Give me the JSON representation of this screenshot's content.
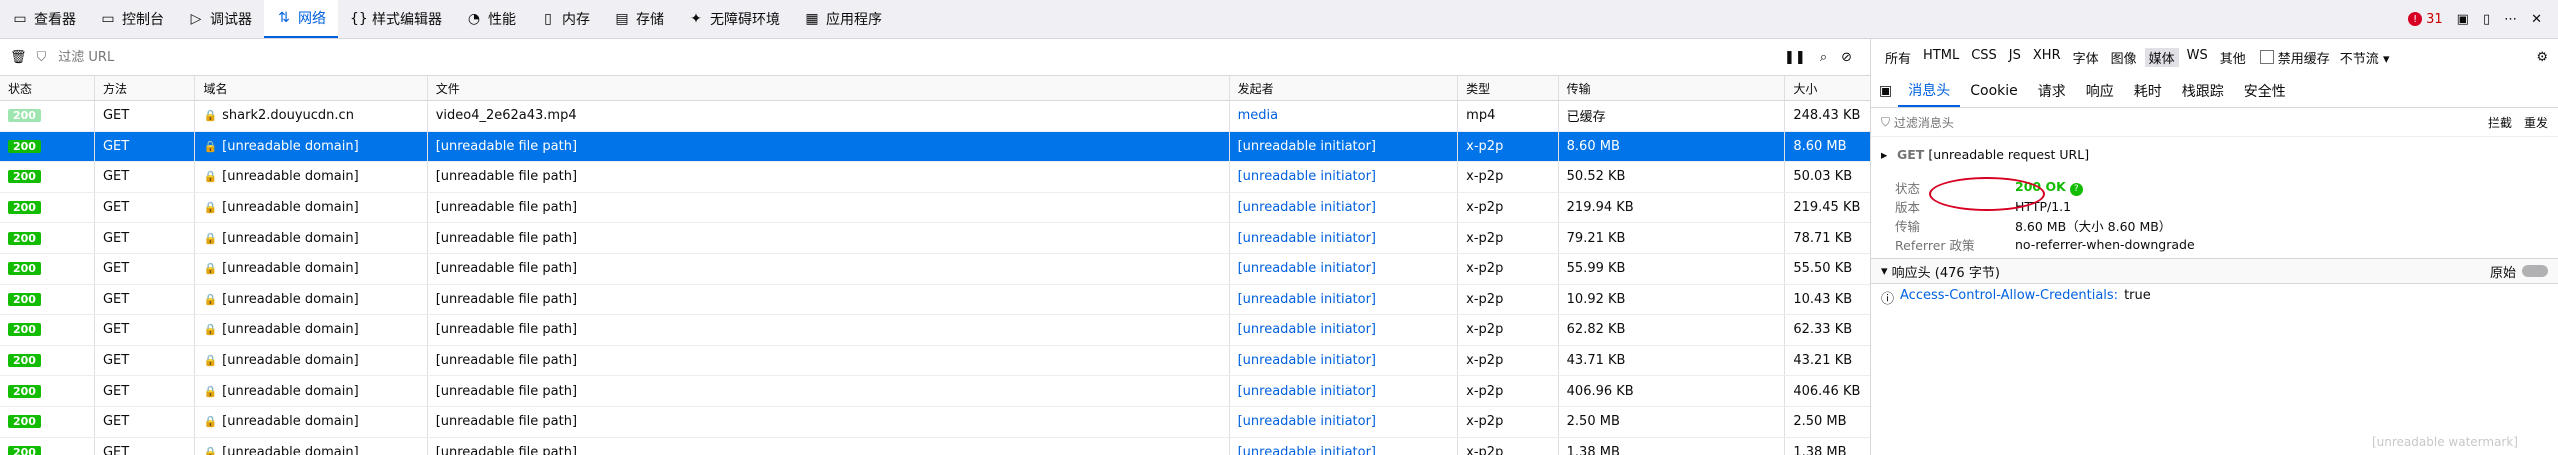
{
  "toolbar": {
    "tabs": [
      {
        "label": "查看器",
        "icon": "▭"
      },
      {
        "label": "控制台",
        "icon": "▭"
      },
      {
        "label": "调试器",
        "icon": "▷"
      },
      {
        "label": "网络",
        "icon": "⇅"
      },
      {
        "label": "样式编辑器",
        "icon": "{}"
      },
      {
        "label": "性能",
        "icon": "◔"
      },
      {
        "label": "内存",
        "icon": "▯"
      },
      {
        "label": "存储",
        "icon": "▤"
      },
      {
        "label": "无障碍环境",
        "icon": "✦"
      },
      {
        "label": "应用程序",
        "icon": "▦"
      }
    ],
    "error_count": "31"
  },
  "filter": {
    "placeholder": "过滤 URL"
  },
  "table": {
    "headers": {
      "status": "状态",
      "method": "方法",
      "domain": "域名",
      "file": "文件",
      "initiator": "发起者",
      "type": "类型",
      "transferred": "传输",
      "size": "大小"
    },
    "rows": [
      {
        "status": "200",
        "method": "GET",
        "domain": "shark2.douyucdn.cn",
        "file": "video4_2e62a43.mp4",
        "initiator": "media",
        "type": "mp4",
        "transferred": "已缓存",
        "size": "248.43 KB",
        "cached": true
      },
      {
        "status": "200",
        "method": "GET",
        "domain": "[unreadable domain]",
        "file": "[unreadable file path]",
        "initiator": "[unreadable initiator]",
        "type": "x-p2p",
        "transferred": "8.60 MB",
        "size": "8.60 MB",
        "selected": true
      },
      {
        "status": "200",
        "method": "GET",
        "domain": "[unreadable domain]",
        "file": "[unreadable file path]",
        "initiator": "[unreadable initiator]",
        "type": "x-p2p",
        "transferred": "50.52 KB",
        "size": "50.03 KB"
      },
      {
        "status": "200",
        "method": "GET",
        "domain": "[unreadable domain]",
        "file": "[unreadable file path]",
        "initiator": "[unreadable initiator]",
        "type": "x-p2p",
        "transferred": "219.94 KB",
        "size": "219.45 KB"
      },
      {
        "status": "200",
        "method": "GET",
        "domain": "[unreadable domain]",
        "file": "[unreadable file path]",
        "initiator": "[unreadable initiator]",
        "type": "x-p2p",
        "transferred": "79.21 KB",
        "size": "78.71 KB"
      },
      {
        "status": "200",
        "method": "GET",
        "domain": "[unreadable domain]",
        "file": "[unreadable file path]",
        "initiator": "[unreadable initiator]",
        "type": "x-p2p",
        "transferred": "55.99 KB",
        "size": "55.50 KB"
      },
      {
        "status": "200",
        "method": "GET",
        "domain": "[unreadable domain]",
        "file": "[unreadable file path]",
        "initiator": "[unreadable initiator]",
        "type": "x-p2p",
        "transferred": "10.92 KB",
        "size": "10.43 KB"
      },
      {
        "status": "200",
        "method": "GET",
        "domain": "[unreadable domain]",
        "file": "[unreadable file path]",
        "initiator": "[unreadable initiator]",
        "type": "x-p2p",
        "transferred": "62.82 KB",
        "size": "62.33 KB"
      },
      {
        "status": "200",
        "method": "GET",
        "domain": "[unreadable domain]",
        "file": "[unreadable file path]",
        "initiator": "[unreadable initiator]",
        "type": "x-p2p",
        "transferred": "43.71 KB",
        "size": "43.21 KB"
      },
      {
        "status": "200",
        "method": "GET",
        "domain": "[unreadable domain]",
        "file": "[unreadable file path]",
        "initiator": "[unreadable initiator]",
        "type": "x-p2p",
        "transferred": "406.96 KB",
        "size": "406.46 KB"
      },
      {
        "status": "200",
        "method": "GET",
        "domain": "[unreadable domain]",
        "file": "[unreadable file path]",
        "initiator": "[unreadable initiator]",
        "type": "x-p2p",
        "transferred": "2.50 MB",
        "size": "2.50 MB"
      },
      {
        "status": "200",
        "method": "GET",
        "domain": "[unreadable domain]",
        "file": "[unreadable file path]",
        "initiator": "[unreadable initiator]",
        "type": "x-p2p",
        "transferred": "1.38 MB",
        "size": "1.38 MB"
      }
    ]
  },
  "type_filters": [
    "所有",
    "HTML",
    "CSS",
    "JS",
    "XHR",
    "字体",
    "图像",
    "媒体",
    "WS",
    "其他"
  ],
  "type_filter_selected": "媒体",
  "disable_cache_label": "禁用缓存",
  "throttle_label": "不节流",
  "details": {
    "tabs": [
      "消息头",
      "Cookie",
      "请求",
      "响应",
      "耗时",
      "栈跟踪",
      "安全性"
    ],
    "filter_placeholder": "过滤消息头",
    "block_label": "拦截",
    "resend_label": "重发",
    "method": "GET",
    "url_parts": [
      {
        "text": "[unreadable request URL]"
      }
    ],
    "summary": [
      {
        "k": "状态",
        "v": "200 OK"
      },
      {
        "k": "版本",
        "v": "HTTP/1.1"
      },
      {
        "k": "传输",
        "v": "8.60 MB（大小 8.60 MB）"
      },
      {
        "k": "Referrer 政策",
        "v": "no-referrer-when-downgrade"
      }
    ],
    "response_headers_label": "响应头 (476 字节)",
    "raw_label": "原始",
    "header_key": "Access-Control-Allow-Credentials:",
    "header_val": "true"
  },
  "watermark": "[unreadable watermark]"
}
